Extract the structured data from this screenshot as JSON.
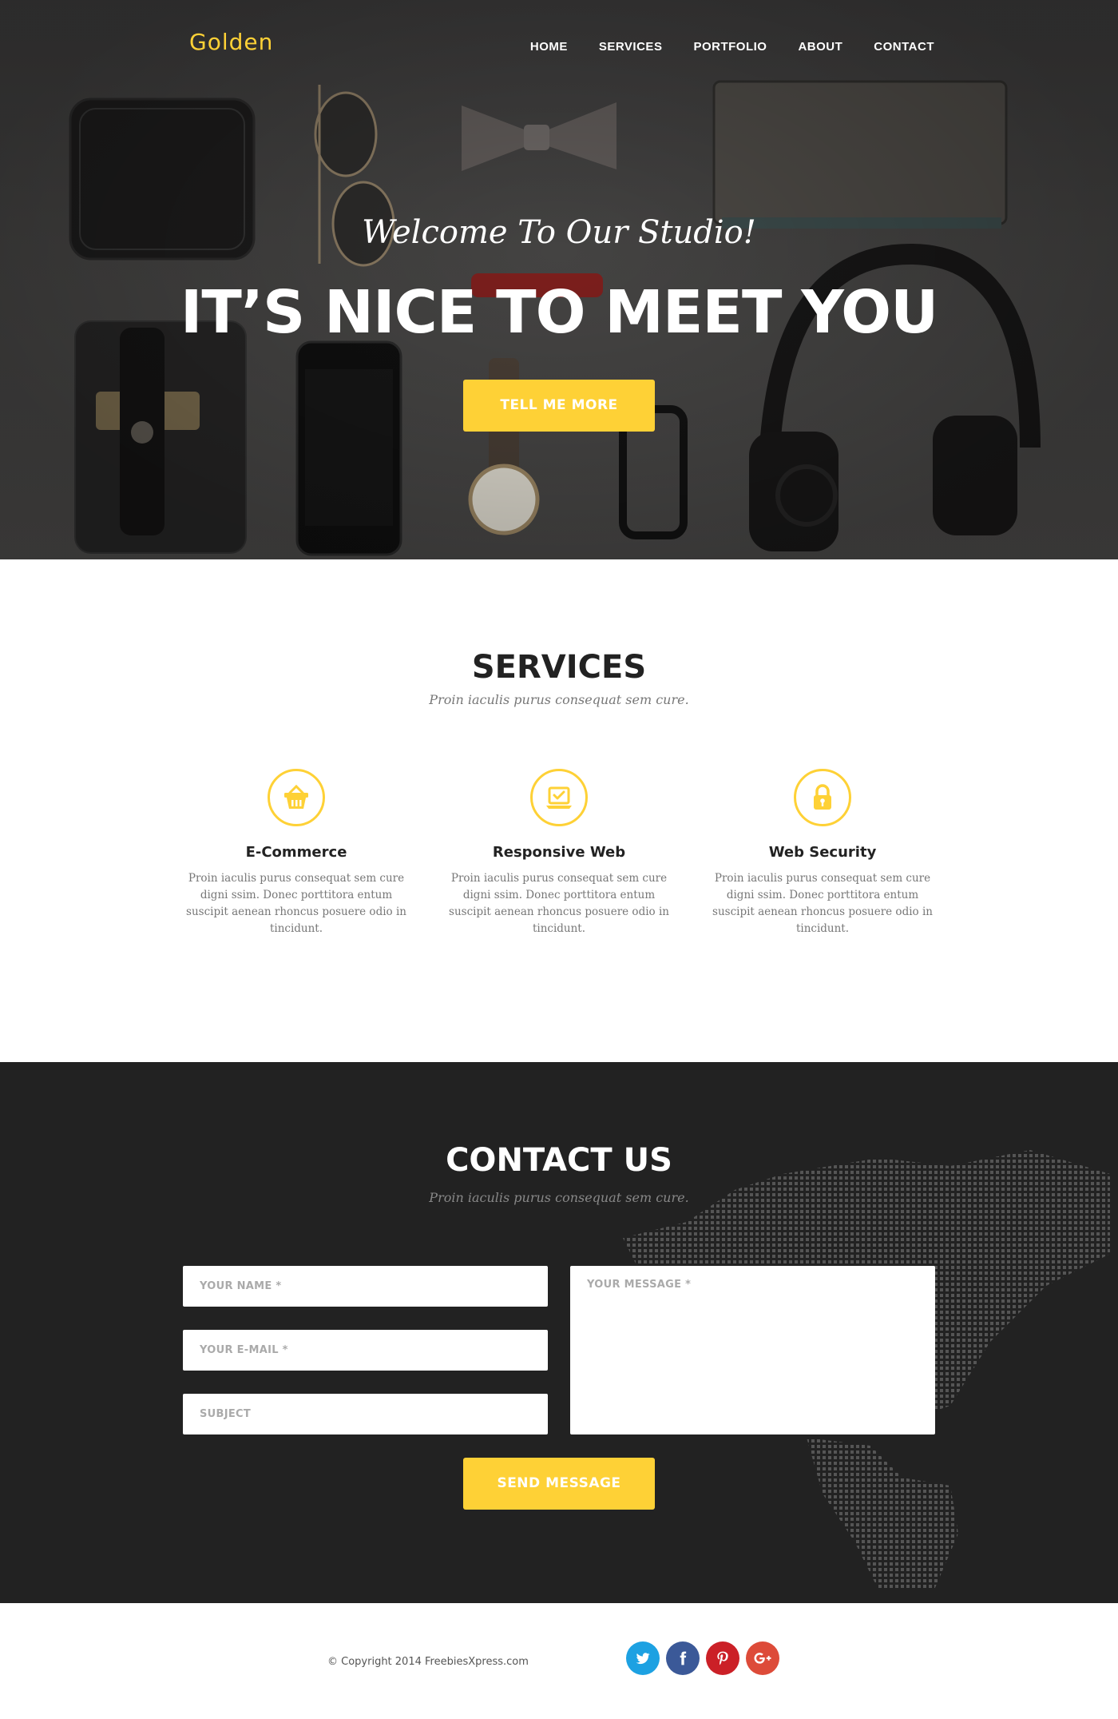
{
  "brand": {
    "name": "Golden",
    "accent": "#fed136"
  },
  "nav": {
    "items": [
      {
        "label": "HOME"
      },
      {
        "label": "SERVICES"
      },
      {
        "label": "PORTFOLIO"
      },
      {
        "label": "ABOUT"
      },
      {
        "label": "CONTACT"
      }
    ]
  },
  "hero": {
    "welcome": "Welcome To Our Studio!",
    "headline": "IT’S NICE TO MEET YOU",
    "button_label": "TELL ME MORE"
  },
  "services": {
    "title": "SERVICES",
    "subtitle": "Proin iaculis purus consequat sem cure.",
    "items": [
      {
        "icon": "basket-icon",
        "title": "E-Commerce",
        "text": "Proin iaculis purus consequat sem cure digni ssim. Donec porttitora entum suscipit aenean rhoncus posuere odio in tincidunt."
      },
      {
        "icon": "laptop-check-icon",
        "title": "Responsive Web",
        "text": "Proin iaculis purus consequat sem cure digni ssim. Donec porttitora entum suscipit aenean rhoncus posuere odio in tincidunt."
      },
      {
        "icon": "lock-icon",
        "title": "Web Security",
        "text": "Proin iaculis purus consequat sem cure digni ssim. Donec porttitora entum suscipit aenean rhoncus posuere odio in tincidunt."
      }
    ]
  },
  "contact": {
    "title": "CONTACT US",
    "subtitle": "Proin iaculis purus consequat sem cure.",
    "name_placeholder": "YOUR NAME *",
    "email_placeholder": "YOUR E-MAIL *",
    "subject_placeholder": "SUBJECT",
    "message_placeholder": "YOUR MESSAGE *",
    "send_label": "SEND MESSAGE"
  },
  "footer": {
    "copyright": "© Copyright 2014 FreebiesXpress.com",
    "social": [
      {
        "icon": "twitter-icon",
        "color": "#1da1e2"
      },
      {
        "icon": "facebook-icon",
        "color": "#3b5998"
      },
      {
        "icon": "pinterest-icon",
        "color": "#cb2027"
      },
      {
        "icon": "google-plus-icon",
        "color": "#dd4b39"
      }
    ]
  }
}
